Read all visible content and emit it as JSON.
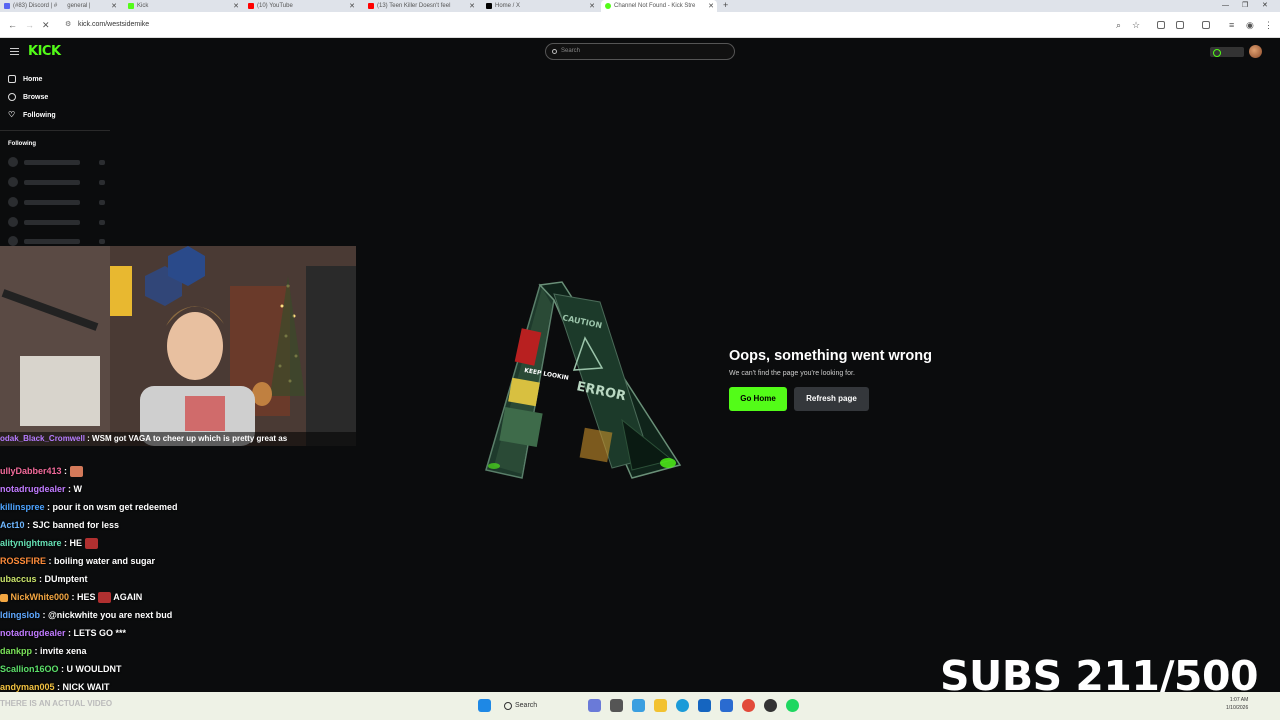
{
  "browser": {
    "tabs": [
      {
        "label": "(#83) Discord | #",
        "extra": "general |",
        "fav": "#5865f2"
      },
      {
        "label": "Kick",
        "fav": "#53fc18"
      },
      {
        "label": "(10) YouTube",
        "fav": "#ff0000"
      },
      {
        "label": "(13) Teen Killer Doesn't feel",
        "fav": "#ff0000"
      },
      {
        "label": "Home / X",
        "fav": "#000000"
      },
      {
        "label": "Channel Not Found - Kick Stre",
        "fav": "#53fc18"
      }
    ],
    "url": "kick.com/westsidemike"
  },
  "kick": {
    "logo": "KICK",
    "search_placeholder": "Search",
    "nav": [
      {
        "label": "Home",
        "icon": "home-icon"
      },
      {
        "label": "Browse",
        "icon": "compass-icon"
      },
      {
        "label": "Following",
        "icon": "heart-icon"
      }
    ],
    "following_heading": "Following",
    "accent": "#53fc18"
  },
  "error": {
    "title": "Oops, something went wrong",
    "subtitle": "We can't find the page you're looking for.",
    "go_home": "Go Home",
    "refresh": "Refresh page",
    "sign_text": "ERROR",
    "sign_caution": "CAUTION",
    "sign_keep": "KEEP LOOKIN"
  },
  "webcam_caption": {
    "user": "odak_Black_Cromwell",
    "msg": ": WSM     got VAGA to cheer up which is pretty great as"
  },
  "chat": [
    {
      "user": "ullyDabber413",
      "color": "#f26b9b",
      "msg": "",
      "emote": "#d47a5a"
    },
    {
      "user": "notadrugdealer",
      "color": "#c07bff",
      "msg": "W"
    },
    {
      "user": "killinspree",
      "color": "#4da3ff",
      "msg": "pour it on wsm get redeemed"
    },
    {
      "user": "Act10",
      "color": "#6fb7ff",
      "msg": "SJC banned for less"
    },
    {
      "user": "alitynightmare",
      "color": "#65e0b4",
      "msg": "HE",
      "emote": "#b03030"
    },
    {
      "user": "ROSSFIRE",
      "color": "#ff8c3a",
      "msg": "boiling water and sugar"
    },
    {
      "user": "ubaccus",
      "color": "#c9e36a",
      "msg": "DUmptent"
    },
    {
      "user": "NickWhite000",
      "color": "#f4a742",
      "msg": "HES",
      "emote": "#b03030",
      "after": "AGAIN"
    },
    {
      "user": "ldingslob",
      "color": "#5fa8ff",
      "msg": "@nickwhite you are next bud"
    },
    {
      "user": "notadrugdealer",
      "color": "#c07bff",
      "msg": "LETS GO ***"
    },
    {
      "user": "dankpp",
      "color": "#7be35a",
      "msg": "invite xena"
    },
    {
      "user": "Scallion16OO",
      "color": "#5ce06a",
      "msg": "U WOULDNT"
    },
    {
      "user": "andyman005",
      "color": "#f0c040",
      "msg": "NICK WAIT"
    }
  ],
  "subs": "SUBS 211/500",
  "taskbar": {
    "left_text": "THERE IS AN ACTUAL VIDEO",
    "search": "Search",
    "time": "1:07 AM",
    "date": "1/10/2026"
  }
}
